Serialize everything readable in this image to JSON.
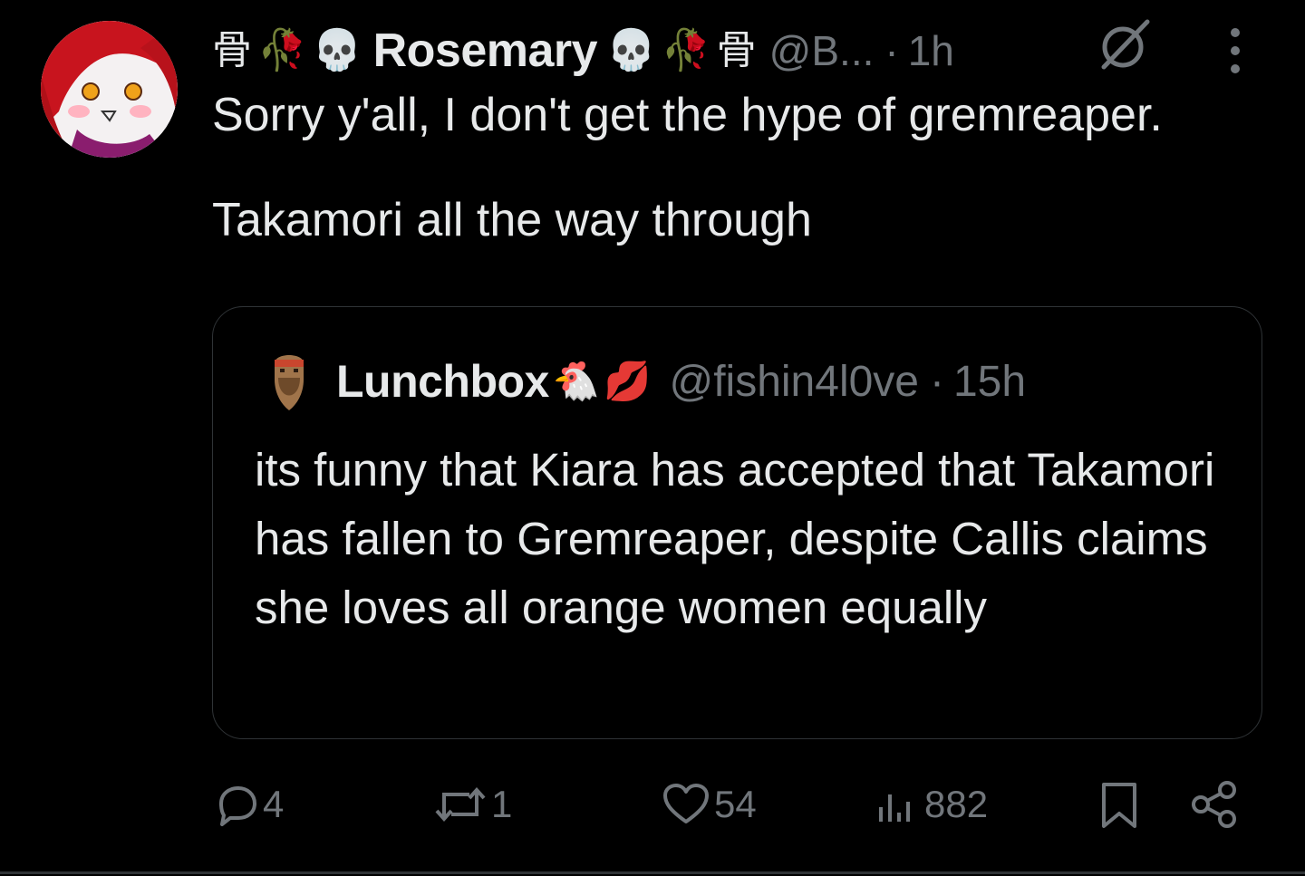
{
  "tweet": {
    "author_deco_left": [
      "骨",
      "🥀",
      "💀"
    ],
    "author_name": "Rosemary",
    "author_deco_right": [
      "💀",
      "🥀",
      "骨"
    ],
    "handle": "@B...",
    "dot": "·",
    "time": "1h",
    "text": "Sorry y'all, I don't get the hype of gremreaper.\n\nTakamori all the way through"
  },
  "quote": {
    "name": "Lunchbox",
    "emojis": [
      "🐔",
      "💋"
    ],
    "handle": "@fishin4l0ve",
    "dot": "·",
    "time": "15h",
    "text": "its funny that Kiara has accepted that Takamori has fallen to Gremreaper, despite Callis claims she loves all orange women equally"
  },
  "actions": {
    "replies": "4",
    "reposts": "1",
    "likes": "54",
    "views": "882"
  },
  "icons": {
    "more": "more-vertical-icon",
    "reply": "reply-icon",
    "repost": "repost-icon",
    "like": "heart-icon",
    "views": "views-icon",
    "bookmark": "bookmark-icon",
    "share": "share-icon",
    "null": "null-circle-icon"
  },
  "colors": {
    "background": "#000000",
    "text": "#e7e9ea",
    "muted": "#71767b",
    "border": "#2f3336"
  }
}
